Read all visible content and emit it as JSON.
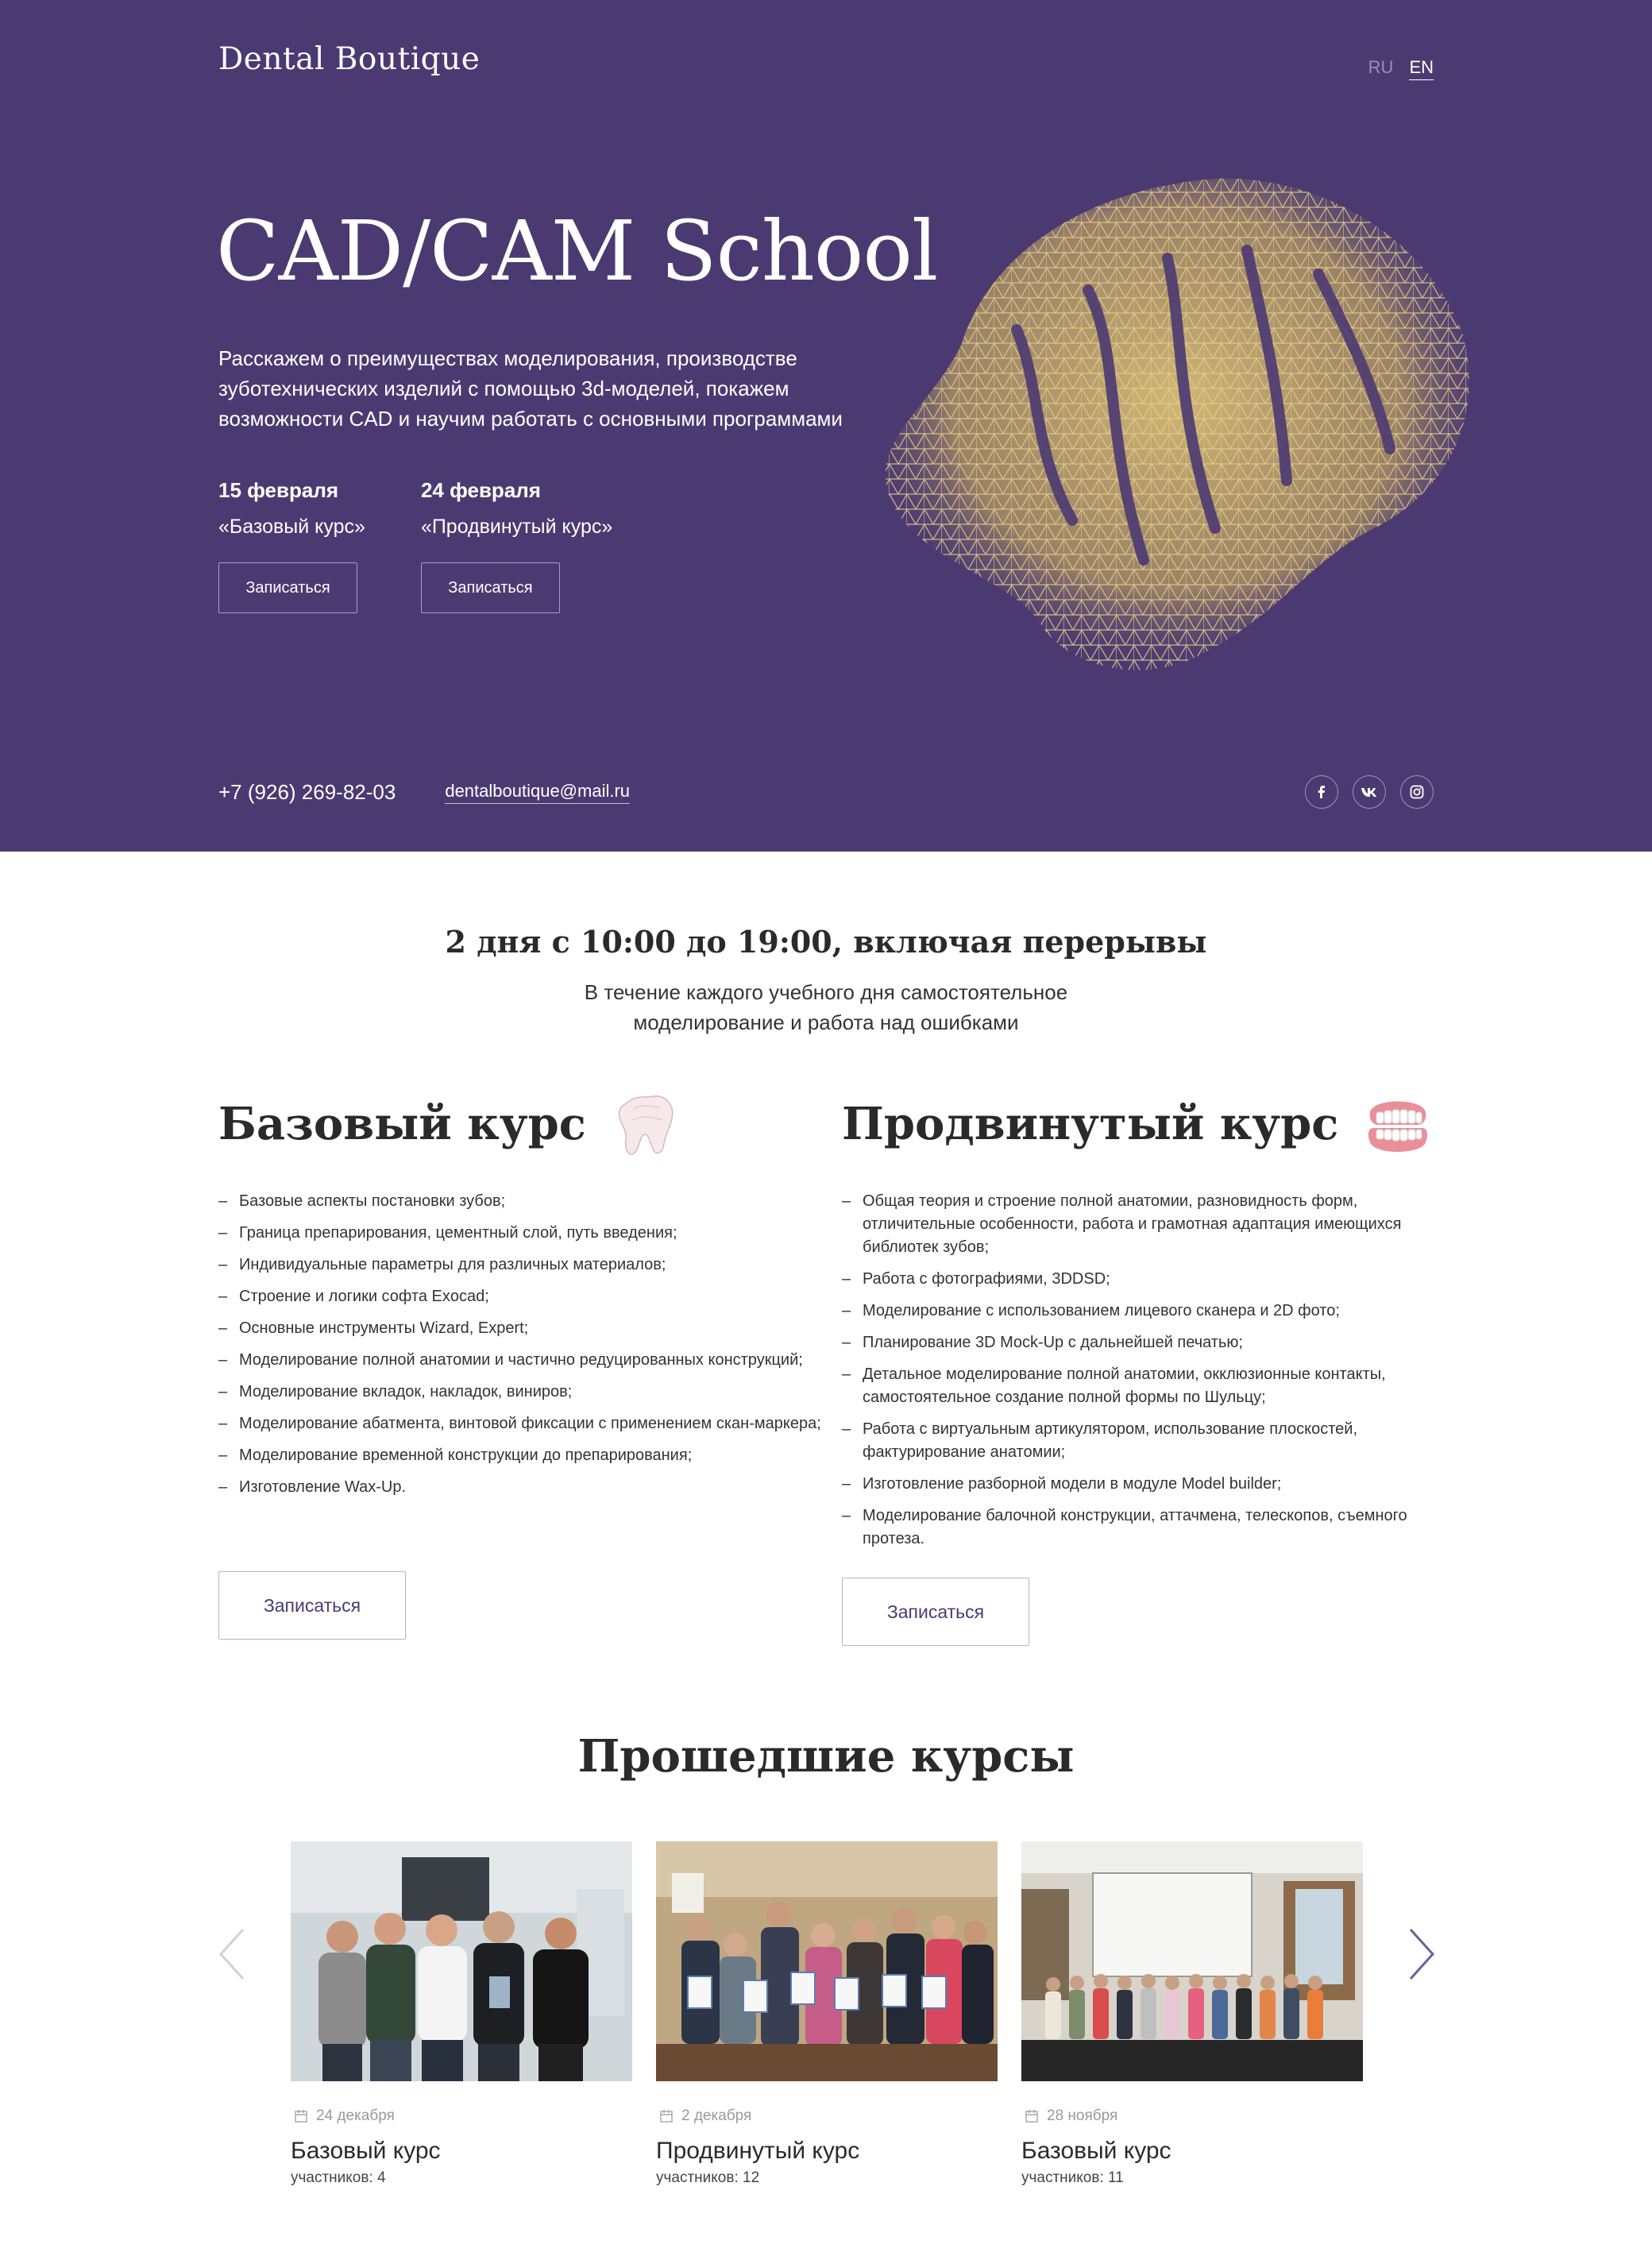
{
  "header": {
    "logo": "Dental Boutique",
    "lang_ru": "RU",
    "lang_en": "EN"
  },
  "hero": {
    "title": "CAD/CAM School",
    "description_lines": [
      "Расскажем о преимуществах моделирования, производстве",
      "зуботехнических изделий с помощью 3d-моделей, покажем",
      "возможности CAD и научим работать с основными программами"
    ],
    "sessions": [
      {
        "date": "15 февраля",
        "course": "«Базовый курс»",
        "button": "Записаться"
      },
      {
        "date": "24 февраля",
        "course": "«Продвинутый курс»",
        "button": "Записаться"
      }
    ],
    "phone": "+7 (926) 269-82-03",
    "email": "dentalboutique@mail.ru",
    "socials": [
      "facebook-icon",
      "vk-icon",
      "instagram-icon"
    ],
    "accent_color": "#4b3a72",
    "art_color": "#e2c77f"
  },
  "schedule": {
    "title": "2 дня с 10:00 до 19:00, включая перерывы",
    "subtitle_lines": [
      "В течение каждого учебного дня самостоятельное",
      "моделирование и работа над ошибками"
    ]
  },
  "courses": {
    "basic": {
      "title": "Базовый курс",
      "icon": "tooth-icon",
      "items": [
        "Базовые аспекты постановки зубов;",
        "Граница препарирования, цементный слой, путь введения;",
        "Индивидуальные параметры для различных материалов;",
        "Строение и логики софта Exocad;",
        "Основные инструменты Wizard, Expert;",
        "Моделирование полной анатомии и частично редуцированных конструкций;",
        "Моделирование вкладок, накладок, виниров;",
        "Моделирование абатмента, винтовой фиксации с применением скан-маркера;",
        "Моделирование временной конструкции до препарирования;",
        "Изготовление Wax-Up."
      ],
      "button": "Записаться"
    },
    "advanced": {
      "title": "Продвинутый курс",
      "icon": "jaw-icon",
      "items": [
        "Общая теория и строение полной анатомии, разновидность форм, отличительные особенности, работа и грамотная адаптация имеющихся библиотек зубов;",
        "Работа с фотографиями, 3DDSD;",
        "Моделирование с использованием лицевого сканера и 2D фото;",
        "Планирование 3D Mock-Up с дальнейшей печатью;",
        "Детальное моделирование полной анатомии, окклюзионные контакты, самостоятельное создание полной формы по Шульцу;",
        "Работа с виртуальным артикулятором, использование плоскостей, фактурирование анатомии;",
        "Изготовление разборной модели в модуле Model builder;",
        "Моделирование балочной конструкции, аттачмена, телескопов, съемного протеза."
      ],
      "button": "Записаться"
    }
  },
  "past": {
    "title": "Прошедшие курсы",
    "cards": [
      {
        "date": "24 декабря",
        "title": "Базовый курс",
        "count": "участников: 4"
      },
      {
        "date": "2 декабря",
        "title": "Продвинутый курс",
        "count": "участников: 12"
      },
      {
        "date": "28 ноября",
        "title": "Базовый курс",
        "count": "участников: 11"
      }
    ]
  }
}
